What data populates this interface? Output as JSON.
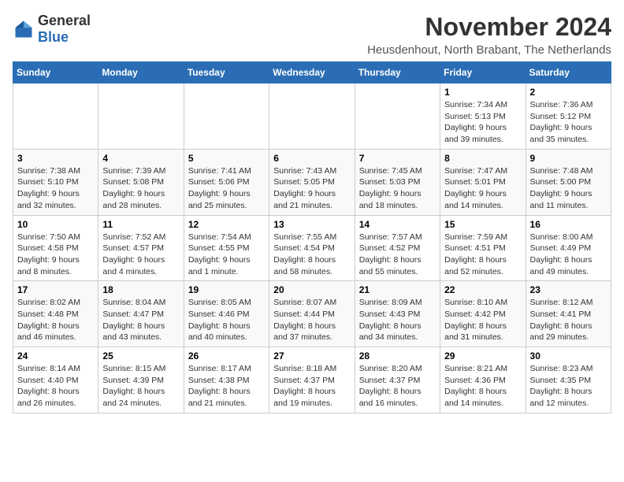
{
  "logo": {
    "general": "General",
    "blue": "Blue"
  },
  "title": "November 2024",
  "subtitle": "Heusdenhout, North Brabant, The Netherlands",
  "days_of_week": [
    "Sunday",
    "Monday",
    "Tuesday",
    "Wednesday",
    "Thursday",
    "Friday",
    "Saturday"
  ],
  "weeks": [
    [
      {
        "day": "",
        "info": ""
      },
      {
        "day": "",
        "info": ""
      },
      {
        "day": "",
        "info": ""
      },
      {
        "day": "",
        "info": ""
      },
      {
        "day": "",
        "info": ""
      },
      {
        "day": "1",
        "info": "Sunrise: 7:34 AM\nSunset: 5:13 PM\nDaylight: 9 hours and 39 minutes."
      },
      {
        "day": "2",
        "info": "Sunrise: 7:36 AM\nSunset: 5:12 PM\nDaylight: 9 hours and 35 minutes."
      }
    ],
    [
      {
        "day": "3",
        "info": "Sunrise: 7:38 AM\nSunset: 5:10 PM\nDaylight: 9 hours and 32 minutes."
      },
      {
        "day": "4",
        "info": "Sunrise: 7:39 AM\nSunset: 5:08 PM\nDaylight: 9 hours and 28 minutes."
      },
      {
        "day": "5",
        "info": "Sunrise: 7:41 AM\nSunset: 5:06 PM\nDaylight: 9 hours and 25 minutes."
      },
      {
        "day": "6",
        "info": "Sunrise: 7:43 AM\nSunset: 5:05 PM\nDaylight: 9 hours and 21 minutes."
      },
      {
        "day": "7",
        "info": "Sunrise: 7:45 AM\nSunset: 5:03 PM\nDaylight: 9 hours and 18 minutes."
      },
      {
        "day": "8",
        "info": "Sunrise: 7:47 AM\nSunset: 5:01 PM\nDaylight: 9 hours and 14 minutes."
      },
      {
        "day": "9",
        "info": "Sunrise: 7:48 AM\nSunset: 5:00 PM\nDaylight: 9 hours and 11 minutes."
      }
    ],
    [
      {
        "day": "10",
        "info": "Sunrise: 7:50 AM\nSunset: 4:58 PM\nDaylight: 9 hours and 8 minutes."
      },
      {
        "day": "11",
        "info": "Sunrise: 7:52 AM\nSunset: 4:57 PM\nDaylight: 9 hours and 4 minutes."
      },
      {
        "day": "12",
        "info": "Sunrise: 7:54 AM\nSunset: 4:55 PM\nDaylight: 9 hours and 1 minute."
      },
      {
        "day": "13",
        "info": "Sunrise: 7:55 AM\nSunset: 4:54 PM\nDaylight: 8 hours and 58 minutes."
      },
      {
        "day": "14",
        "info": "Sunrise: 7:57 AM\nSunset: 4:52 PM\nDaylight: 8 hours and 55 minutes."
      },
      {
        "day": "15",
        "info": "Sunrise: 7:59 AM\nSunset: 4:51 PM\nDaylight: 8 hours and 52 minutes."
      },
      {
        "day": "16",
        "info": "Sunrise: 8:00 AM\nSunset: 4:49 PM\nDaylight: 8 hours and 49 minutes."
      }
    ],
    [
      {
        "day": "17",
        "info": "Sunrise: 8:02 AM\nSunset: 4:48 PM\nDaylight: 8 hours and 46 minutes."
      },
      {
        "day": "18",
        "info": "Sunrise: 8:04 AM\nSunset: 4:47 PM\nDaylight: 8 hours and 43 minutes."
      },
      {
        "day": "19",
        "info": "Sunrise: 8:05 AM\nSunset: 4:46 PM\nDaylight: 8 hours and 40 minutes."
      },
      {
        "day": "20",
        "info": "Sunrise: 8:07 AM\nSunset: 4:44 PM\nDaylight: 8 hours and 37 minutes."
      },
      {
        "day": "21",
        "info": "Sunrise: 8:09 AM\nSunset: 4:43 PM\nDaylight: 8 hours and 34 minutes."
      },
      {
        "day": "22",
        "info": "Sunrise: 8:10 AM\nSunset: 4:42 PM\nDaylight: 8 hours and 31 minutes."
      },
      {
        "day": "23",
        "info": "Sunrise: 8:12 AM\nSunset: 4:41 PM\nDaylight: 8 hours and 29 minutes."
      }
    ],
    [
      {
        "day": "24",
        "info": "Sunrise: 8:14 AM\nSunset: 4:40 PM\nDaylight: 8 hours and 26 minutes."
      },
      {
        "day": "25",
        "info": "Sunrise: 8:15 AM\nSunset: 4:39 PM\nDaylight: 8 hours and 24 minutes."
      },
      {
        "day": "26",
        "info": "Sunrise: 8:17 AM\nSunset: 4:38 PM\nDaylight: 8 hours and 21 minutes."
      },
      {
        "day": "27",
        "info": "Sunrise: 8:18 AM\nSunset: 4:37 PM\nDaylight: 8 hours and 19 minutes."
      },
      {
        "day": "28",
        "info": "Sunrise: 8:20 AM\nSunset: 4:37 PM\nDaylight: 8 hours and 16 minutes."
      },
      {
        "day": "29",
        "info": "Sunrise: 8:21 AM\nSunset: 4:36 PM\nDaylight: 8 hours and 14 minutes."
      },
      {
        "day": "30",
        "info": "Sunrise: 8:23 AM\nSunset: 4:35 PM\nDaylight: 8 hours and 12 minutes."
      }
    ]
  ]
}
